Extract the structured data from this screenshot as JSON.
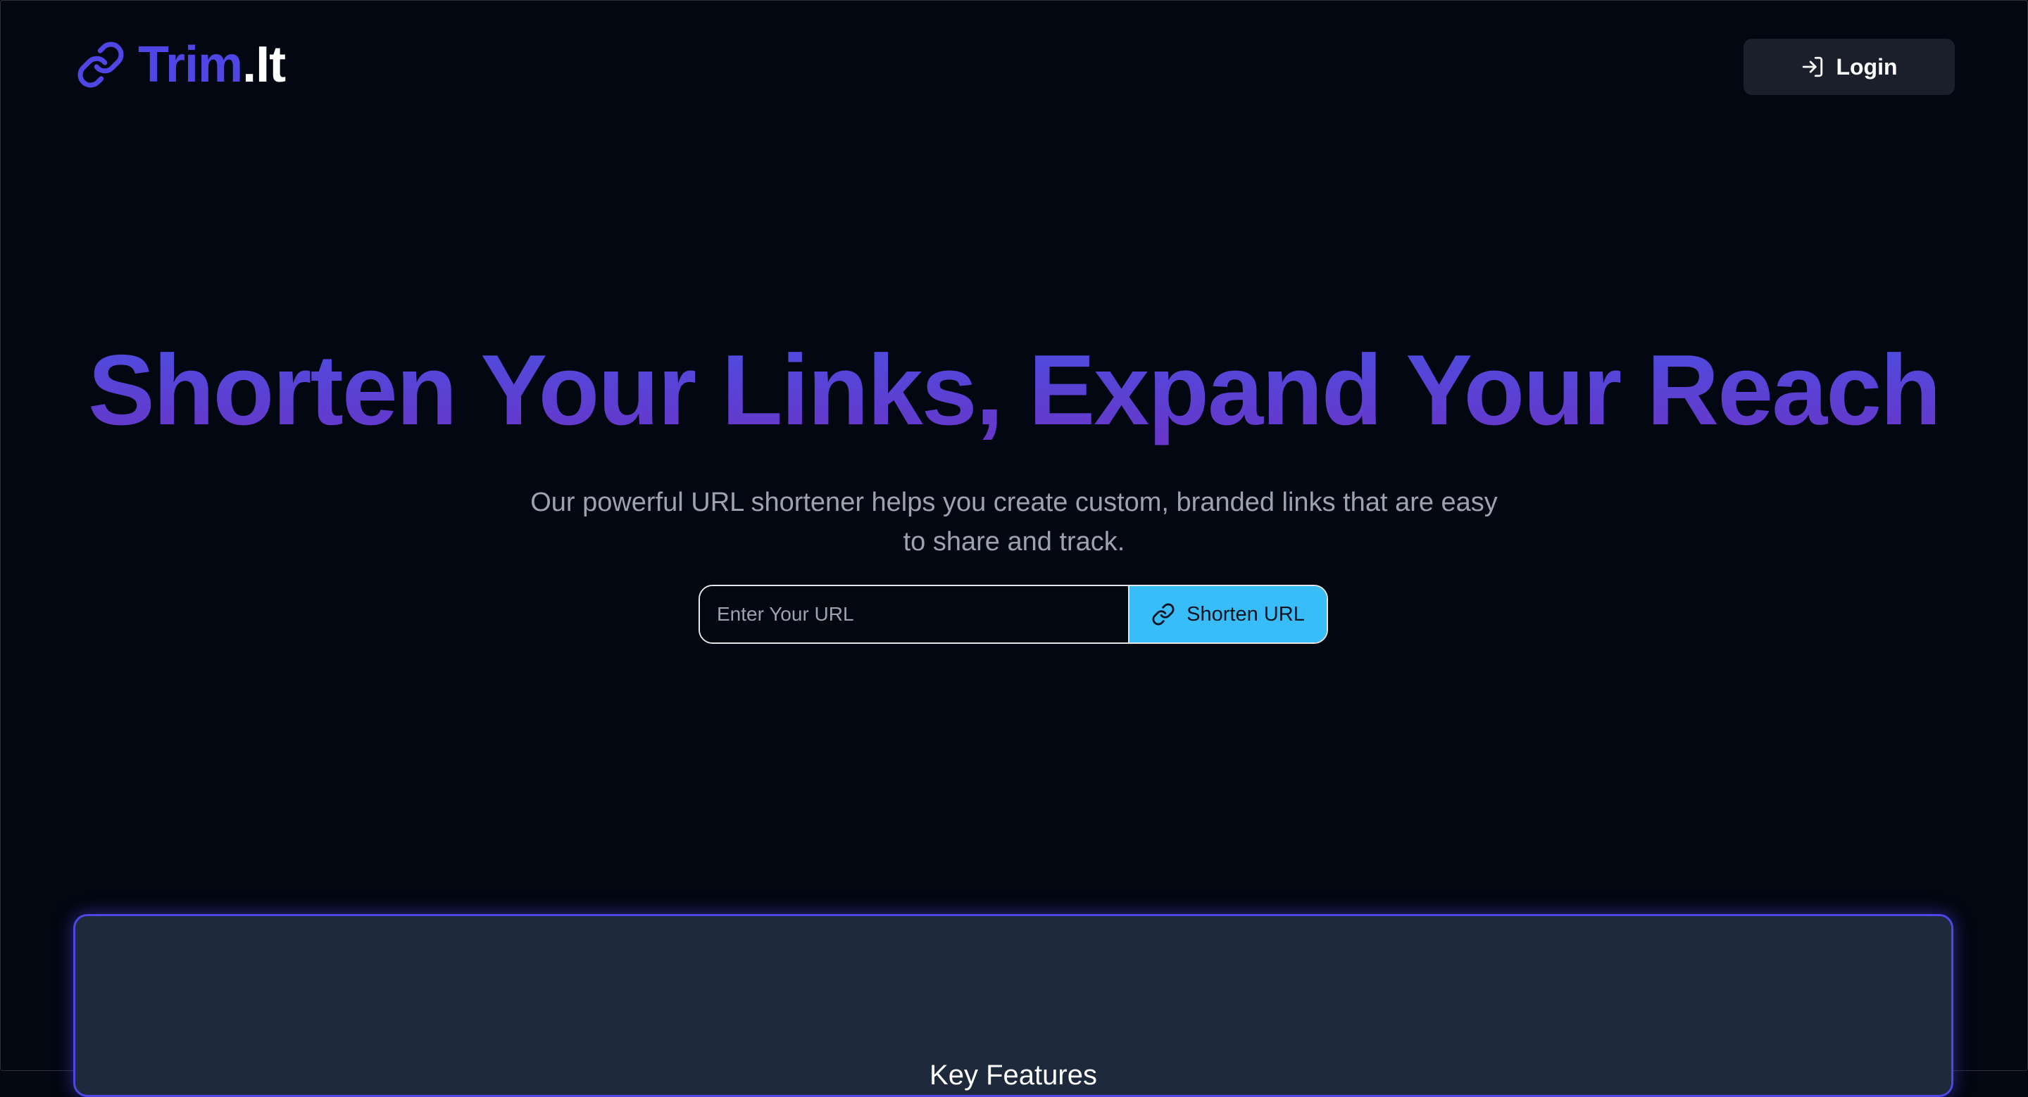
{
  "header": {
    "logo_trim": "Trim",
    "logo_it": ".It",
    "login_label": "Login"
  },
  "hero": {
    "title": "Shorten Your Links, Expand Your Reach",
    "subtitle": "Our powerful URL shortener helps you create custom, branded links that are easy to share and track."
  },
  "form": {
    "url_placeholder": "Enter Your URL",
    "url_value": "",
    "shorten_label": "Shorten URL"
  },
  "features": {
    "title": "Key Features"
  },
  "icons": {
    "logo": "link-icon",
    "login": "login-icon",
    "shorten": "link-icon"
  },
  "colors": {
    "background": "#030712",
    "brand": "#4f46e5",
    "accent_button": "#38bdf8",
    "card_background": "#1e293b",
    "title_gradient_top": "#4a4fe2",
    "title_gradient_bottom": "#6a34c6"
  }
}
